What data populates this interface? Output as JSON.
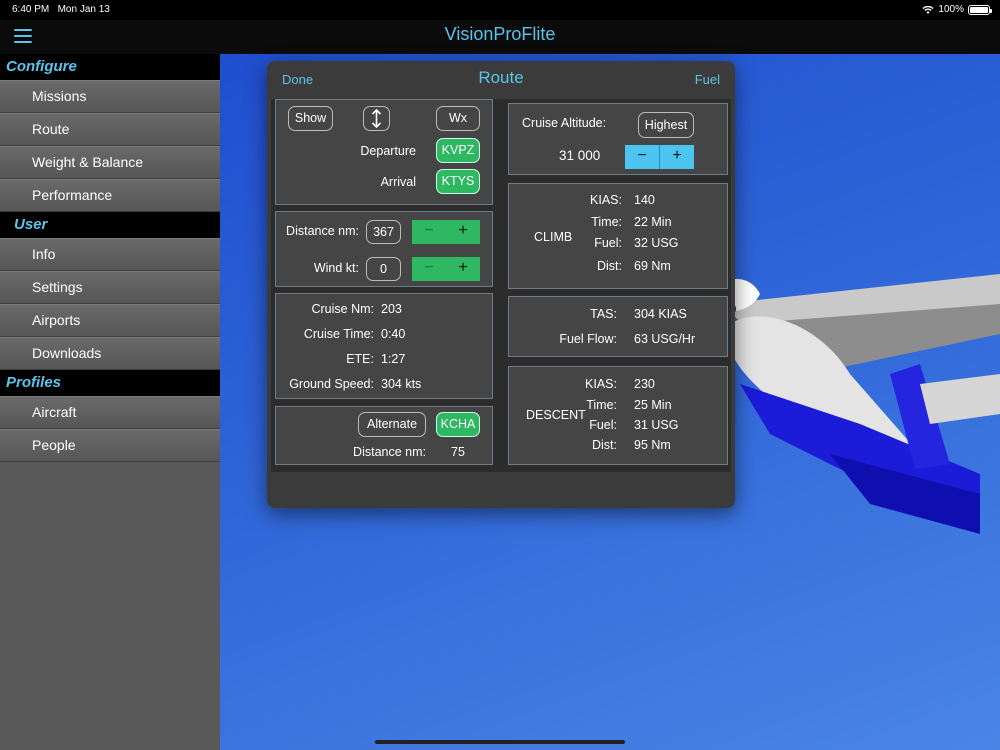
{
  "status": {
    "time": "6:40 PM",
    "date": "Mon Jan 13",
    "battery": "100%",
    "battery_level": 1.0
  },
  "nav": {
    "title": "VisionProFlite"
  },
  "sidebar": {
    "sections": [
      {
        "title": "Configure",
        "items": [
          "Missions",
          "Route",
          "Weight & Balance",
          "Performance"
        ]
      },
      {
        "title": "User",
        "items": [
          "Info",
          "Settings",
          "Airports",
          "Downloads"
        ]
      },
      {
        "title": "Profiles",
        "items": [
          "Aircraft",
          "People"
        ]
      }
    ]
  },
  "panel": {
    "done": "Done",
    "title": "Route",
    "fuel": "Fuel",
    "route": {
      "show": "Show",
      "swap_icon": "swap-vertical-icon",
      "wx": "Wx",
      "departure_label": "Departure",
      "departure": "KVPZ",
      "arrival_label": "Arrival",
      "arrival": "KTYS"
    },
    "distance": {
      "label": "Distance nm:",
      "value": "367",
      "minus": "−",
      "plus": "+"
    },
    "wind": {
      "label": "Wind kt:",
      "value": "0",
      "minus": "−",
      "plus": "+"
    },
    "cruise_stats": [
      {
        "label": "Cruise Nm:",
        "value": "203"
      },
      {
        "label": "Cruise Time:",
        "value": "0:40"
      },
      {
        "label": "ETE:",
        "value": "1:27"
      },
      {
        "label": "Ground Speed:",
        "value": "304  kts"
      }
    ],
    "alternate": {
      "button": "Alternate",
      "airport": "KCHA",
      "distance_label": "Distance nm:",
      "distance": "75"
    },
    "cruise_altitude": {
      "label": "Cruise Altitude:",
      "mode": "Highest",
      "value": "31 000",
      "minus": "−",
      "plus": "+"
    },
    "climb": {
      "title": "CLIMB",
      "rows": [
        {
          "label": "KIAS:",
          "value": "140"
        },
        {
          "label": "Time:",
          "value": "22  Min"
        },
        {
          "label": "Fuel:",
          "value": "32  USG"
        },
        {
          "label": "Dist:",
          "value": "69  Nm"
        }
      ]
    },
    "cruise": {
      "rows": [
        {
          "label": "TAS:",
          "value": "304  KIAS"
        },
        {
          "label": "Fuel Flow:",
          "value": "63  USG/Hr"
        }
      ]
    },
    "descent": {
      "title": "DESCENT",
      "rows": [
        {
          "label": "KIAS:",
          "value": "230"
        },
        {
          "label": "Time:",
          "value": "25  Min"
        },
        {
          "label": "Fuel:",
          "value": "31  USG"
        },
        {
          "label": "Dist:",
          "value": "95  Nm"
        }
      ]
    }
  }
}
